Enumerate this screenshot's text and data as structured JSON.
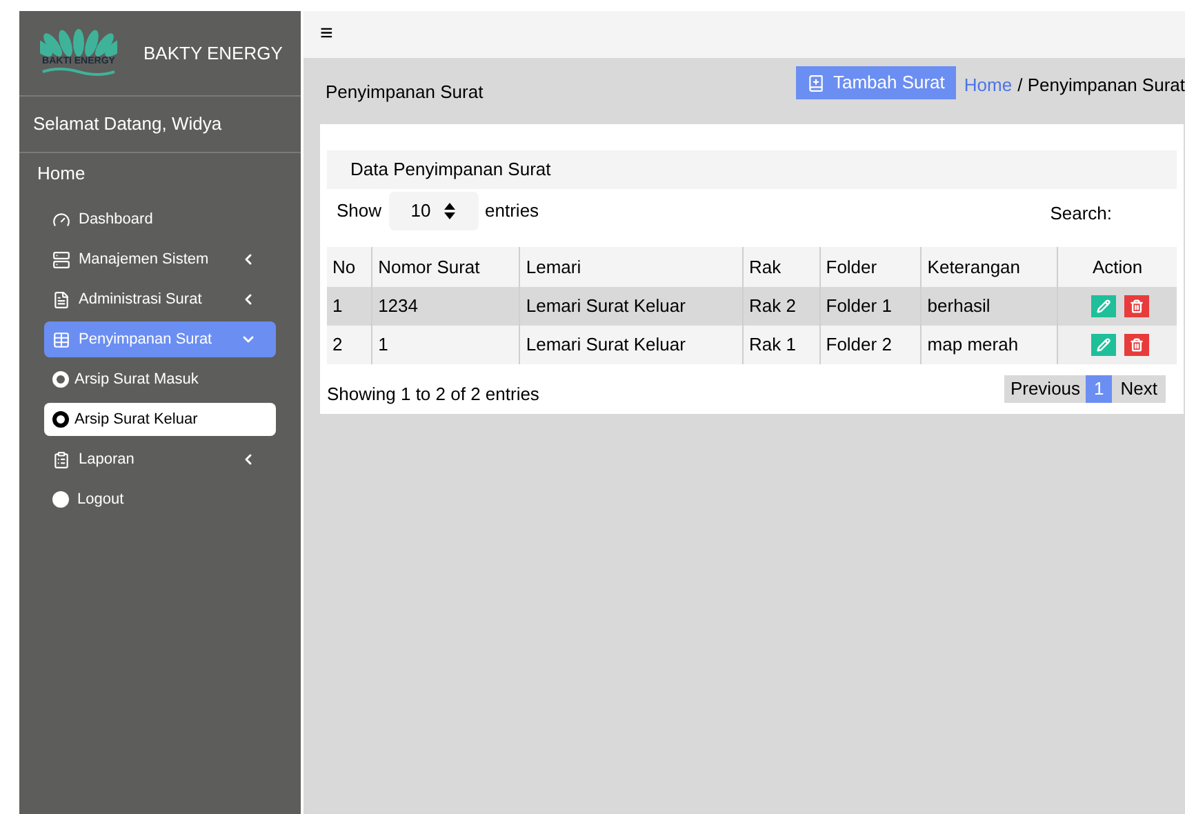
{
  "sidebar": {
    "brand": "BAKTY ENERGY",
    "logo_text": "BAKTI ENERGY",
    "welcome": "Selamat Datang, Widya",
    "section": "Home",
    "items": [
      {
        "label": "Dashboard",
        "selected": false
      },
      {
        "label": "Manajemen Sistem",
        "selected": false,
        "expanded": false
      },
      {
        "label": "Administrasi Surat",
        "selected": false,
        "expanded": false
      },
      {
        "label": "Penyimpanan Surat",
        "selected": true,
        "expanded": true,
        "children": [
          {
            "label": "Arsip Surat Masuk",
            "selected": false
          },
          {
            "label": "Arsip Surat Keluar",
            "selected": true
          }
        ]
      },
      {
        "label": "Laporan",
        "selected": false,
        "expanded": false
      },
      {
        "label": "Logout",
        "selected": false
      }
    ]
  },
  "topbar": {
    "menu": "≡"
  },
  "header": {
    "title": "Penyimpanan Surat",
    "add_button": "Tambah Surat",
    "breadcrumb": [
      {
        "label": "Home",
        "link": true
      },
      {
        "label": "/ Penyimpanan Surat",
        "link": false
      }
    ]
  },
  "card": {
    "title": "Data Penyimpanan Surat",
    "show_label": "Show",
    "page_size": "10",
    "entries_label": "entries",
    "search_label": "Search:",
    "table": {
      "columns": [
        "No",
        "Nomor Surat",
        "Lemari",
        "Rak",
        "Folder",
        "Keterangan",
        "Action"
      ],
      "rows": [
        [
          "1",
          "1234",
          "Lemari Surat Keluar",
          "Rak 2",
          "Folder 1",
          "berhasil"
        ],
        [
          "2",
          "1",
          "Lemari Surat Keluar",
          "Rak 1",
          "Folder 2",
          "map merah"
        ]
      ]
    },
    "info": "Showing 1 to 2 of 2 entries",
    "pagination": {
      "previous": "Previous",
      "pages": [
        {
          "label": "1",
          "selected": true
        }
      ],
      "next": "Next"
    }
  }
}
